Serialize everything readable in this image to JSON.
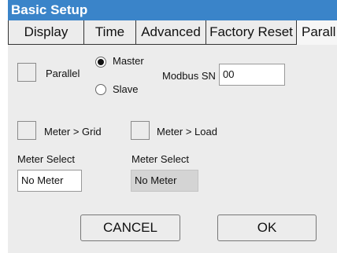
{
  "window": {
    "title": "Basic Setup"
  },
  "tabs": [
    {
      "label": "Display"
    },
    {
      "label": "Time"
    },
    {
      "label": "Advanced"
    },
    {
      "label": "Factory Reset"
    },
    {
      "label": "Parall"
    }
  ],
  "parallel": {
    "checkbox_label": "Parallel",
    "master_label": "Master",
    "slave_label": "Slave",
    "selected_role": "Master"
  },
  "modbus": {
    "label": "Modbus SN",
    "value": "00"
  },
  "meter_grid": {
    "checkbox_label": "Meter > Grid",
    "select_label": "Meter Select",
    "select_value": "No Meter"
  },
  "meter_load": {
    "checkbox_label": "Meter > Load",
    "select_label": "Meter Select",
    "select_value": "No Meter"
  },
  "buttons": {
    "cancel": "CANCEL",
    "ok": "OK"
  }
}
